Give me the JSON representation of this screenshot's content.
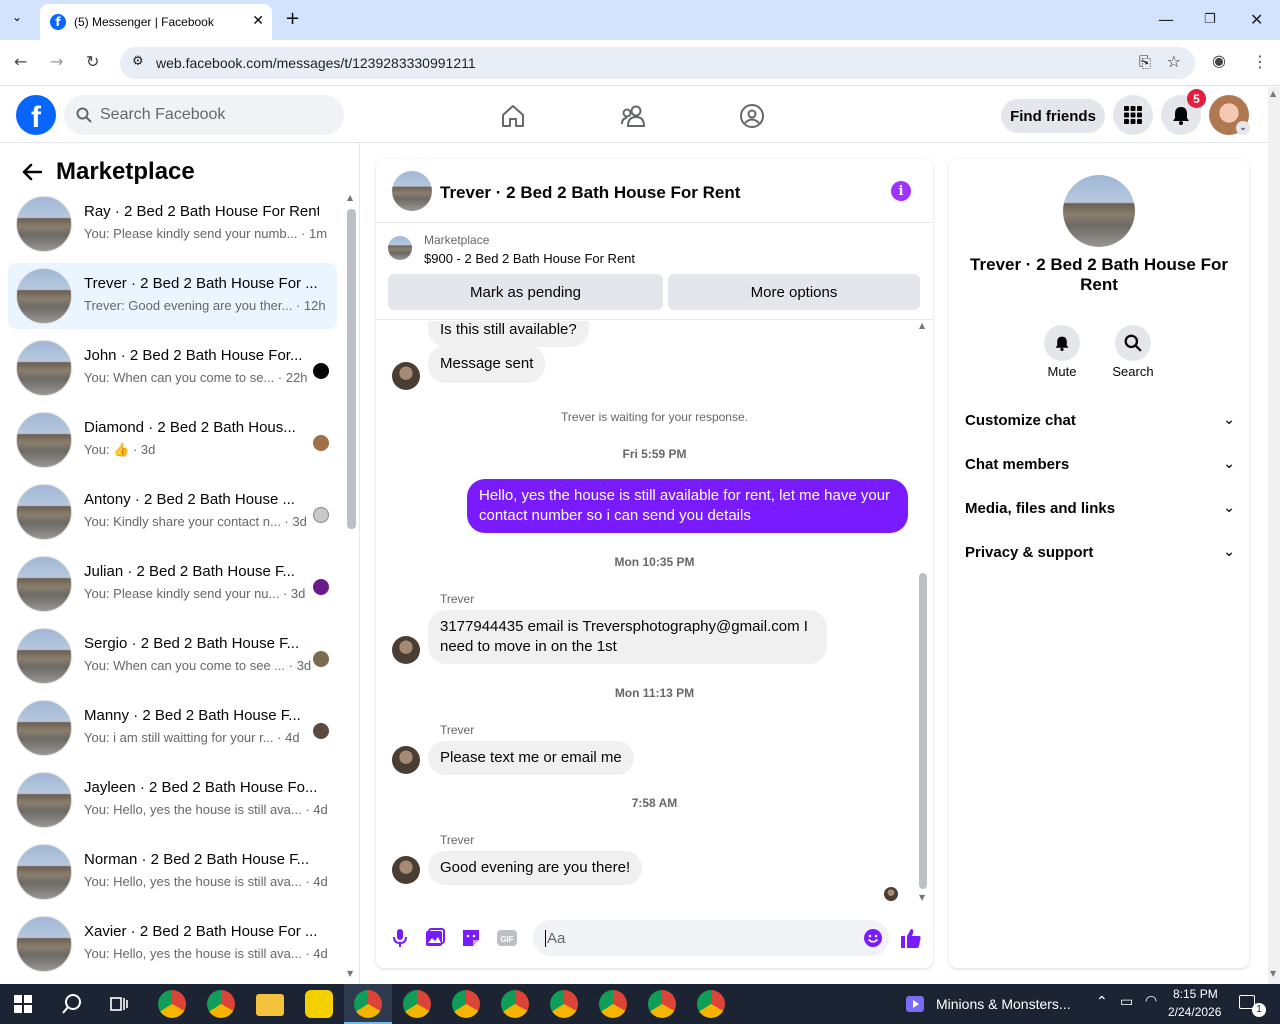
{
  "browser": {
    "tab_title": "(5) Messenger | Facebook",
    "url": "web.facebook.com/messages/t/1239283330991211"
  },
  "header": {
    "search_placeholder": "Search Facebook",
    "find_friends": "Find friends",
    "notification_count": "5"
  },
  "sidebar": {
    "title": "Marketplace",
    "conversations": [
      {
        "name": "Ray · 2 Bed 2 Bath House For Rent",
        "preview": "You: Please kindly send your numb... · 1m",
        "indicator": ""
      },
      {
        "name": "Trever · 2 Bed 2 Bath House For ...",
        "preview": "Trever: Good evening are you ther... · 12h",
        "indicator": ""
      },
      {
        "name": "John · 2 Bed 2 Bath House For...",
        "preview": "You: When can you come to se... · 22h",
        "indicator": "#050505"
      },
      {
        "name": "Diamond · 2 Bed 2 Bath Hous...",
        "preview": "You: 👍 · 3d",
        "indicator": "#a0704a"
      },
      {
        "name": "Antony · 2 Bed 2 Bath House ...",
        "preview": "You: Kindly share your contact n... · 3d",
        "indicator": "#c8c8c8"
      },
      {
        "name": "Julian · 2 Bed 2 Bath House F...",
        "preview": "You: Please kindly send your nu... · 3d",
        "indicator": "#6a1a8a"
      },
      {
        "name": "Sergio · 2 Bed 2 Bath House F...",
        "preview": "You: When can you come to see ... · 3d",
        "indicator": "#7a6a50"
      },
      {
        "name": "Manny · 2 Bed 2 Bath House F...",
        "preview": "You: i am still waitting for your r... · 4d",
        "indicator": "#5a4a40"
      },
      {
        "name": "Jayleen · 2 Bed 2 Bath House Fo...",
        "preview": "You: Hello, yes the house is still ava... · 4d",
        "indicator": ""
      },
      {
        "name": "Norman · 2 Bed 2 Bath House F...",
        "preview": "You: Hello, yes the house is still ava... · 4d",
        "indicator": ""
      },
      {
        "name": "Xavier · 2 Bed 2 Bath House For ...",
        "preview": "You: Hello, yes the house is still ava... · 4d",
        "indicator": ""
      }
    ]
  },
  "chat": {
    "title": "Trever · 2 Bed 2 Bath House For Rent",
    "listing_label": "Marketplace",
    "listing_price": "$900 - 2 Bed 2 Bath House For Rent",
    "mark_pending": "Mark as pending",
    "more_options": "More options",
    "messages": {
      "m1": "Is this still available?",
      "m2": "Message sent",
      "waiting": "Trever is waiting for your response.",
      "t1": "Fri 5:59 PM",
      "m3": "Hello, yes the house is still available for rent, let me have your contact number so i can send you  details",
      "t2": "Mon 10:35 PM",
      "sender": "Trever",
      "m4": "3177944435 email is Treversphotography@gmail.com I need to move in on the 1st",
      "t3": "Mon 11:13 PM",
      "m5": "Please text me or email me",
      "t4": "7:58 AM",
      "m6": "Good evening are you there!"
    },
    "input_placeholder": "Aa"
  },
  "right_panel": {
    "title": "Trever · 2 Bed 2 Bath House For Rent",
    "mute": "Mute",
    "search": "Search",
    "sections": [
      "Customize chat",
      "Chat members",
      "Media, files and links",
      "Privacy & support"
    ]
  },
  "taskbar": {
    "media_title": "Minions & Monsters...",
    "time": "8:15 PM",
    "date": "2/24/2026",
    "notif": "1"
  },
  "colors": {
    "accent": "#7a1bff",
    "facebook_blue": "#0866ff",
    "badge_red": "#e41e3f"
  }
}
